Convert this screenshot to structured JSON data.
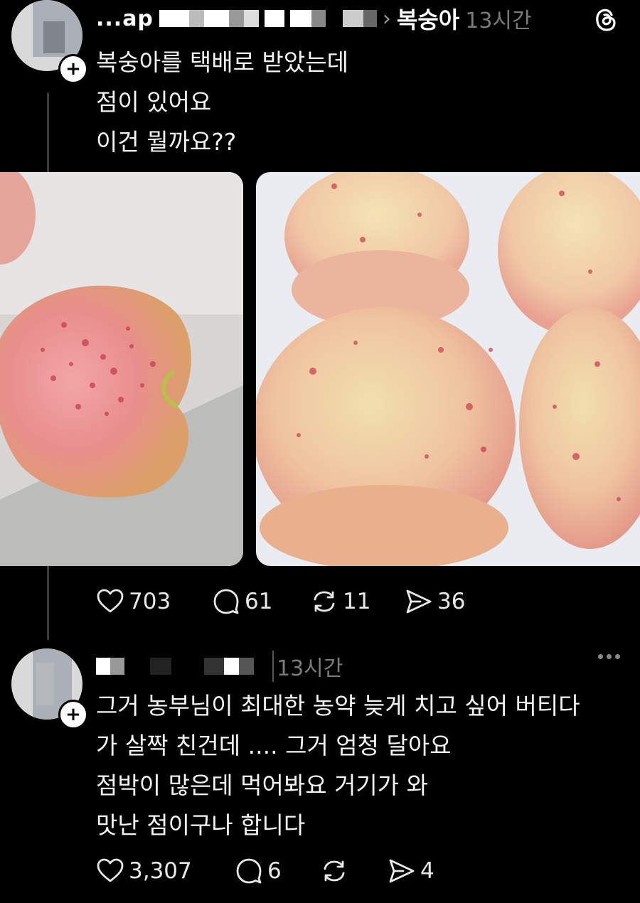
{
  "post": {
    "author_fragment": "...ap",
    "topic": "복숭아",
    "time": "13시간",
    "lines": [
      "복숭아를 택배로 받았는데",
      "점이 있어요",
      "이건 뭘까요??"
    ],
    "likes": "703",
    "replies": "61",
    "reposts": "11",
    "shares": "36"
  },
  "reply": {
    "time": "13시간",
    "lines": [
      "그거 농부님이 최대한 농약 늦게 치고 싶어 버티다",
      "가 살짝 친건데 .... 그거 엄청 달아요",
      "점박이 많은데 먹어봐요 거기가 와",
      "맛난 점이구나 합니다"
    ],
    "likes": "3,307",
    "replies": "6",
    "shares": "4"
  },
  "icons": {
    "app": "threads-logo-icon",
    "like": "heart-icon",
    "reply": "comment-bubble-icon",
    "repost": "repost-icon",
    "share": "send-icon",
    "more": "more-dots-icon",
    "follow": "plus-icon",
    "topic_sep": "chevron-right-icon"
  },
  "colors": {
    "background": "#000000",
    "text": "#f3f5f7",
    "secondary": "#7a7a7a"
  }
}
